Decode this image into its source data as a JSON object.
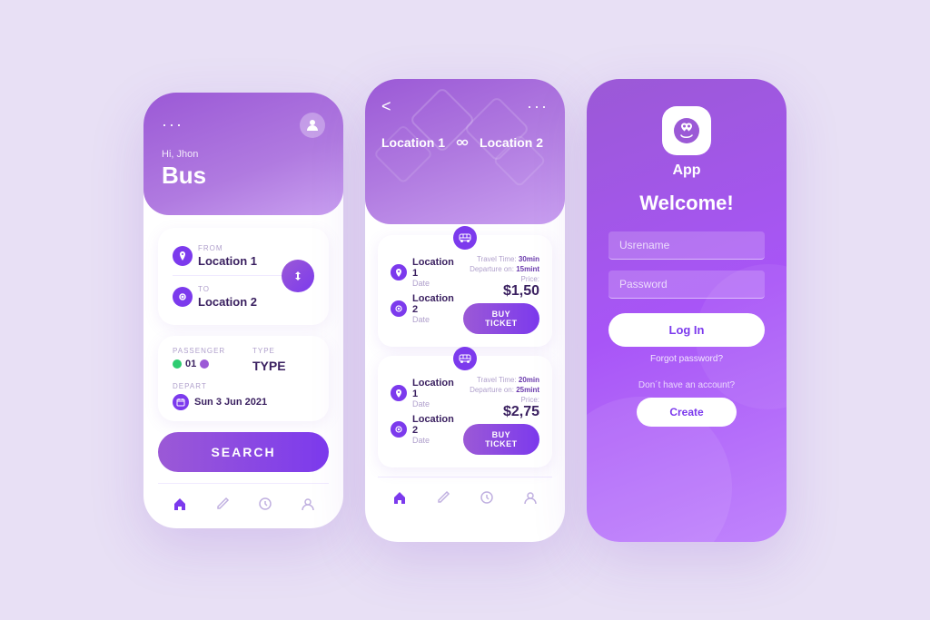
{
  "screen1": {
    "dots": "···",
    "greeting": "Hi, Jhon",
    "title": "Bus",
    "from_label": "FROM",
    "from_value": "Location 1",
    "to_label": "TO",
    "to_value": "Location 2",
    "passenger_label": "PASSENGER",
    "passenger_value": "01",
    "type_label": "TYPE",
    "type_value": "TYPE",
    "depart_label": "DEPART",
    "depart_value": "Sun 3 Jun 2021",
    "search_btn": "SEARCH"
  },
  "screen2": {
    "dots": "···",
    "back": "<",
    "loc1": "Location 1",
    "loc2": "Location 2",
    "tickets": [
      {
        "from": "Location 1",
        "from_sub": "Date",
        "to": "Location 2",
        "to_sub": "Date",
        "travel_label": "Travel Time:",
        "travel_value": "30min",
        "depart_label": "Departure on:",
        "depart_value": "15mint",
        "price_label": "Price:",
        "price": "$1,50",
        "buy_btn": "BUY TICKET"
      },
      {
        "from": "Location 1",
        "from_sub": "Date",
        "to": "Location 2",
        "to_sub": "Date",
        "travel_label": "Travel Time:",
        "travel_value": "20min",
        "depart_label": "Departure on:",
        "depart_value": "25mint",
        "price_label": "Price:",
        "price": "$2,75",
        "buy_btn": "BUY TICKET"
      }
    ]
  },
  "screen3": {
    "app_name": "App",
    "welcome": "Welcome!",
    "username_placeholder": "Usrename",
    "password_placeholder": "Password",
    "login_btn": "Log In",
    "forgot": "Forgot password?",
    "no_account": "Don´t have an account?",
    "create_btn": "Create"
  },
  "nav": {
    "home": "⌂",
    "edit": "✎",
    "clock": "◷",
    "user": "👤"
  }
}
